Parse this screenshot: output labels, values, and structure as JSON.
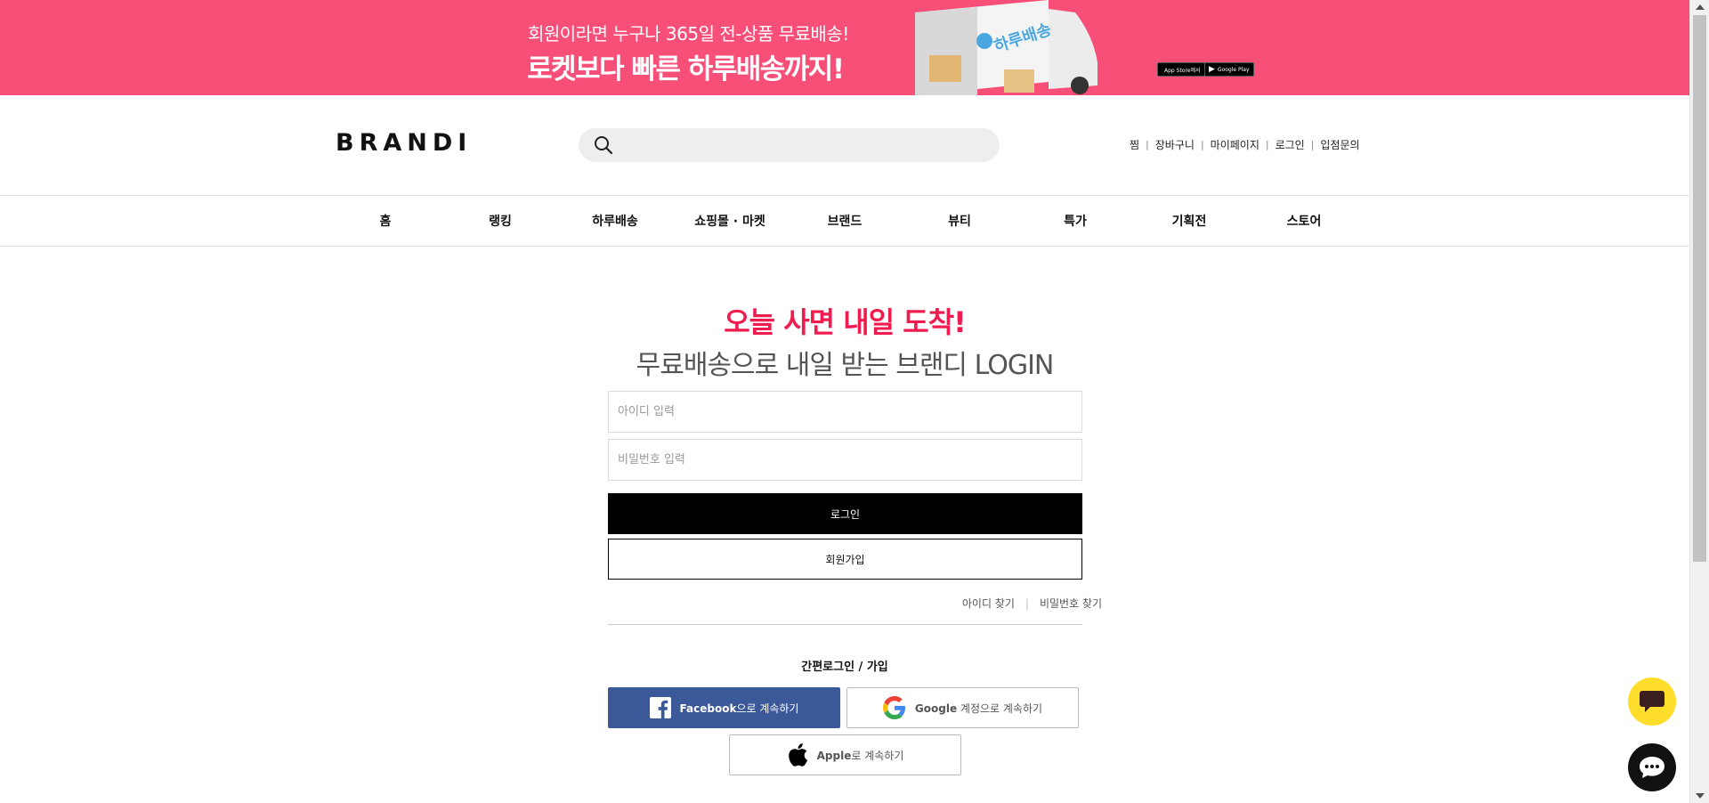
{
  "promo": {
    "line1": "회원이라면 누구나 365일 전-상품 무료배송!",
    "line2": "로켓보다 빠른 하루배송까지!",
    "truck_label": "하루배송",
    "appstore_label": "App Store에서",
    "googleplay_label": "Google Play",
    "background": "#f84f78"
  },
  "header": {
    "logo": "BRANDI",
    "search": {
      "placeholder": "",
      "value": ""
    },
    "util_links": [
      "찜",
      "장바구니",
      "마이페이지",
      "로그인",
      "입점문의"
    ]
  },
  "nav": {
    "items": [
      "홈",
      "랭킹",
      "하루배송",
      "쇼핑몰 · 마켓",
      "브랜드",
      "뷰티",
      "특가",
      "기획전",
      "스토어"
    ]
  },
  "login": {
    "headline": "오늘 사면 내일 도착!",
    "subheadline": "무료배송으로 내일 받는 브랜디 LOGIN",
    "id_placeholder": "아이디 입력",
    "password_placeholder": "비밀번호 입력",
    "login_button": "로그인",
    "join_button": "회원가입",
    "find_id": "아이디 찾기",
    "find_password": "비밀번호 찾기",
    "find_separator": "|",
    "simple_login_title": "간편로그인 / 가입",
    "facebook": {
      "brand": "Facebook",
      "suffix": "으로 계속하기",
      "color": "#3b5998"
    },
    "google": {
      "brand": "Google",
      "suffix": " 계정으로 계속하기"
    },
    "apple": {
      "brand": "Apple",
      "suffix": "로 계속하기"
    }
  },
  "colors": {
    "accent": "#ef1d4f",
    "kakao_yellow": "#fedd2b"
  },
  "floating": {
    "chat_icon": "speech-bubble-icon",
    "talk_icon": "chat-dots-icon"
  }
}
